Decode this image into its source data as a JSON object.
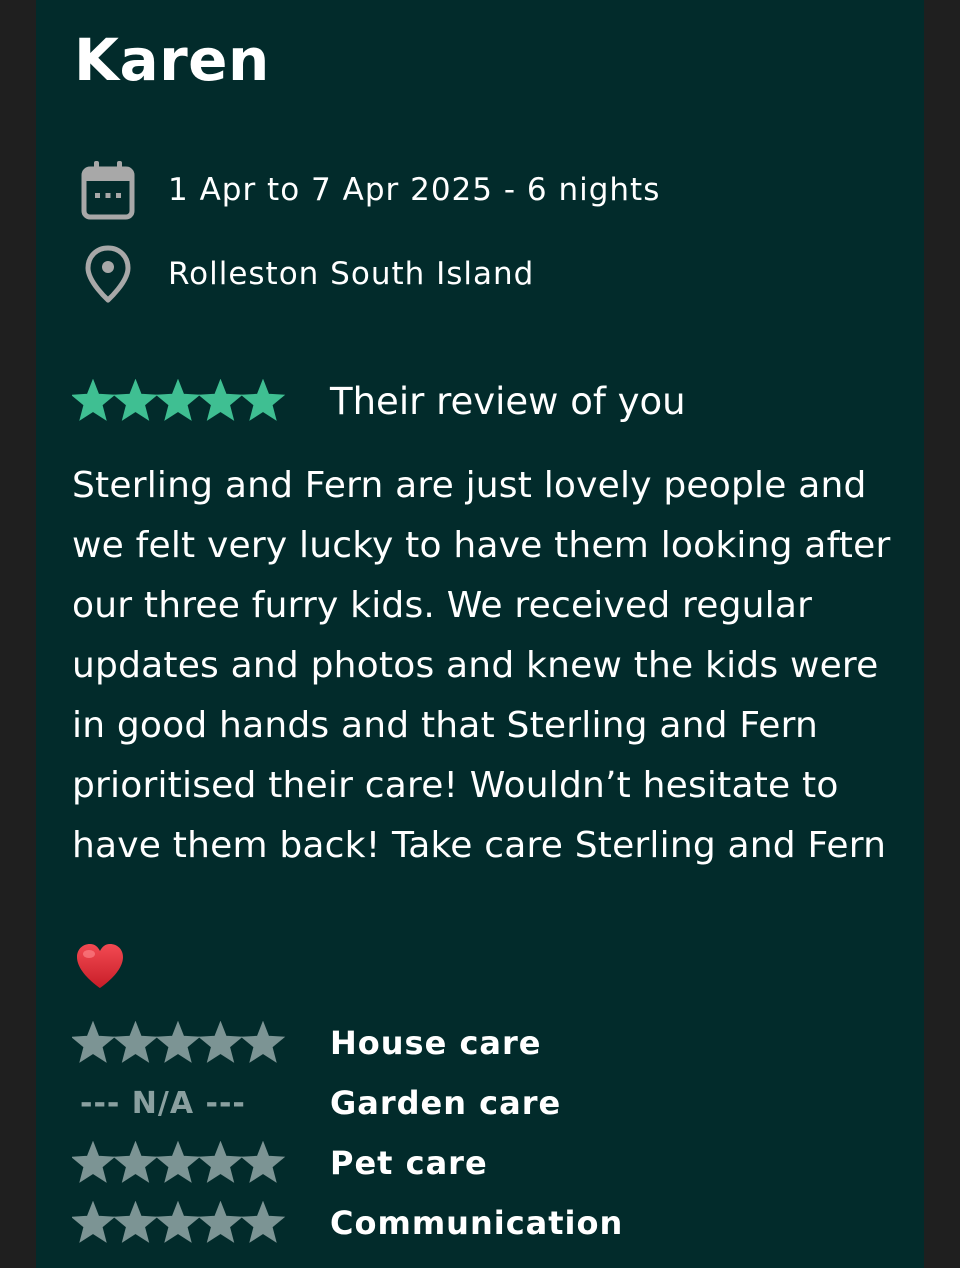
{
  "reviewer": {
    "name": "Karen"
  },
  "stay": {
    "dates": "1 Apr to 7 Apr 2025 - 6 nights",
    "location": "Rolleston South Island",
    "calendar_icon": "calendar-icon",
    "location_icon": "map-pin-icon"
  },
  "overall": {
    "rating": 5,
    "max_rating": 5,
    "label": "Their review of you",
    "star_color": "#3fbf92"
  },
  "review": {
    "text": "Sterling and Fern are just lovely people and we felt very lucky to have them looking after our three furry kids. We received regular updates and photos and knew the kids were in good hands and that Sterling and Fern prioritised their care! Wouldn’t hesitate to have them back! Take care Sterling and Fern",
    "emoji": "❤️"
  },
  "categories": [
    {
      "label": "House care",
      "rating": 5,
      "na_text": ""
    },
    {
      "label": "Garden care",
      "rating": null,
      "na_text": "--- N/A ---"
    },
    {
      "label": "Pet care",
      "rating": 5,
      "na_text": ""
    },
    {
      "label": "Communication",
      "rating": 5,
      "na_text": ""
    }
  ],
  "colors": {
    "card_background": "#022b2b",
    "page_background": "#1f1f1f",
    "sub_star_color": "#7c9494",
    "icon_color": "#a8a8a8",
    "heart_color": "#e8323c"
  }
}
